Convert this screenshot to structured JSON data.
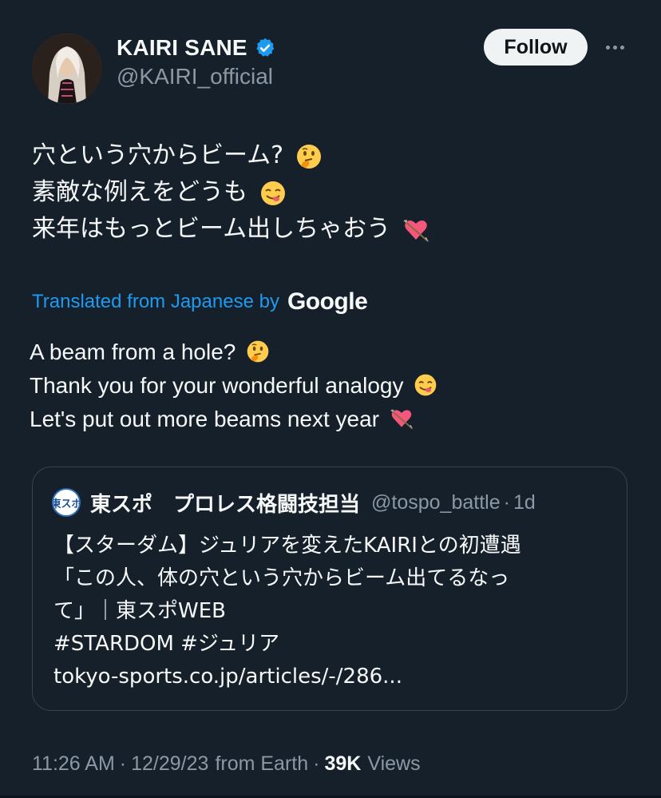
{
  "author": {
    "display_name": "KAIRI SANE",
    "handle": "@KAIRI_official",
    "verified": true,
    "avatar_icon": "profile-photo"
  },
  "actions": {
    "follow_label": "Follow",
    "more_icon": "more-horizontal-icon"
  },
  "tweet": {
    "lines": [
      "穴という穴からビーム?",
      "素敵な例えをどうも",
      "来年はもっとビーム出しちゃおう"
    ],
    "emojis": [
      "thinking-face",
      "face-savoring-food",
      "heart-with-arrow"
    ]
  },
  "translation": {
    "label": "Translated from Japanese by",
    "provider": "Google",
    "lines": [
      "A beam from a hole?",
      "Thank you for your wonderful analogy",
      "Let's put out more beams next year"
    ]
  },
  "quote": {
    "avatar_text": "東スポ",
    "name": "東スポ　プロレス格闘技担当",
    "handle": "@tospo_battle",
    "separator": "·",
    "time": "1d",
    "lines": [
      "【スターダム】ジュリアを変えたKAIRIとの初遭遇",
      "「この人、体の穴という穴からビーム出てるなっ",
      "て」｜東スポWEB",
      "#STARDOM  #ジュリア",
      "tokyo-sports.co.jp/articles/-/286..."
    ]
  },
  "meta": {
    "time": "11:26 AM",
    "date": "12/29/23",
    "source": "from Earth",
    "separator": "·",
    "views_count": "39K",
    "views_label": "Views"
  },
  "colors": {
    "background": "#15202b",
    "accent": "#1d9bf0",
    "secondary_text": "#8b98a5",
    "border": "#38444d"
  }
}
